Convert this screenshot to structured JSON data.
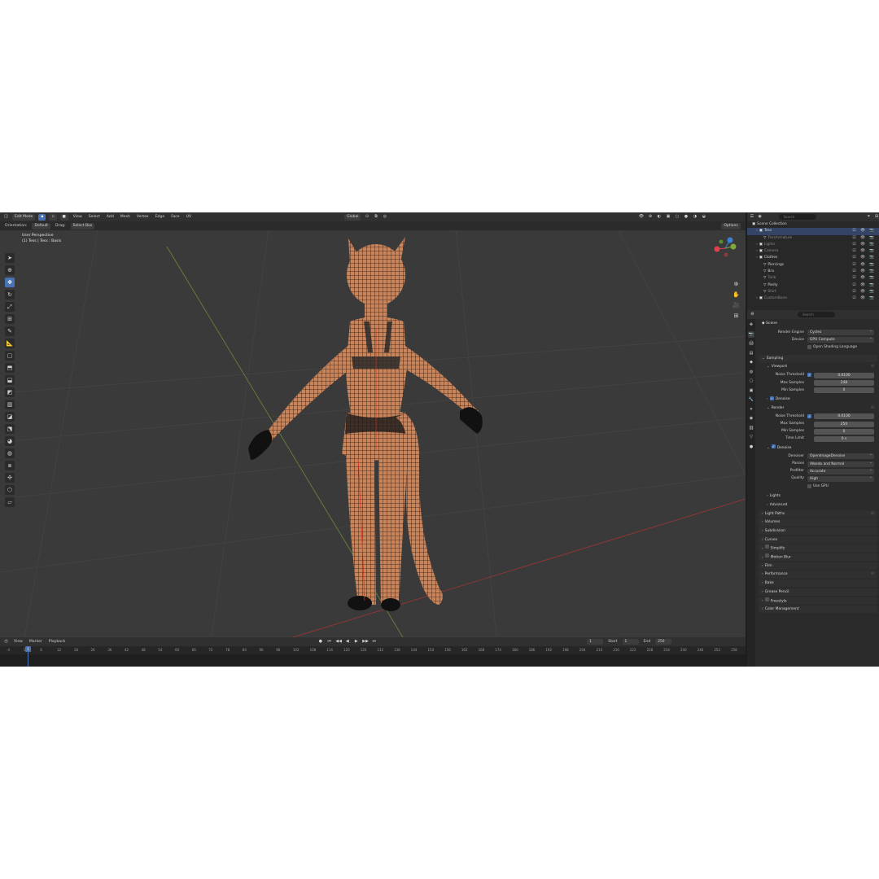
{
  "header": {
    "mode": "Edit Mode",
    "menus": [
      "View",
      "Select",
      "Add",
      "Mesh",
      "Vertex",
      "Edge",
      "Face",
      "UV"
    ],
    "transform_orientation": "Global",
    "options_label": "Options",
    "orientation_label": "Orientation:",
    "orientation_value": "Default",
    "drag_label": "Drag:",
    "drag_value": "Select Box"
  },
  "viewport": {
    "view_name": "User Perspective",
    "object_info": "(1) Tess | Tess : Basis",
    "gizmo_labels": [
      "X",
      "Y",
      "Z"
    ]
  },
  "timeline": {
    "menus": [
      "View",
      "Marker",
      "Playback"
    ],
    "current_frame": "1",
    "start_label": "Start",
    "start": "1",
    "end_label": "End",
    "end": "250",
    "ruler": [
      "-4",
      "1",
      "6",
      "12",
      "18",
      "26",
      "36",
      "42",
      "48",
      "54",
      "60",
      "66",
      "72",
      "78",
      "84",
      "90",
      "96",
      "102",
      "108",
      "114",
      "120",
      "126",
      "132",
      "138",
      "144",
      "150",
      "156",
      "162",
      "168",
      "174",
      "180",
      "186",
      "192",
      "198",
      "204",
      "210",
      "216",
      "222",
      "228",
      "234",
      "240",
      "246",
      "252",
      "258"
    ]
  },
  "outliner": {
    "search_placeholder": "Search",
    "rows": [
      {
        "label": "Scene Collection",
        "indent": 0,
        "dim": false
      },
      {
        "label": "Tess",
        "indent": 1,
        "dim": false
      },
      {
        "label": "TessArmature",
        "indent": 2,
        "dim": true
      },
      {
        "label": "Lights",
        "indent": 1,
        "dim": true
      },
      {
        "label": "Camera",
        "indent": 1,
        "dim": true
      },
      {
        "label": "Clothes",
        "indent": 1,
        "dim": false
      },
      {
        "label": "Piercings",
        "indent": 2,
        "dim": false
      },
      {
        "label": "Bra",
        "indent": 2,
        "dim": false
      },
      {
        "label": "Tank",
        "indent": 2,
        "dim": true
      },
      {
        "label": "Panty",
        "indent": 2,
        "dim": false
      },
      {
        "label": "Shirt",
        "indent": 2,
        "dim": true
      },
      {
        "label": "CustomBone",
        "indent": 1,
        "dim": true
      }
    ]
  },
  "properties": {
    "search_placeholder": "Search",
    "scene": "Scene",
    "render_engine_label": "Render Engine",
    "render_engine": "Cycles",
    "device_label": "Device",
    "device": "GPU Compute",
    "osl_label": "Open Shading Language",
    "sampling": "Sampling",
    "viewport": "Viewport",
    "noise_threshold_label": "Noise Threshold",
    "vp_noise_threshold": "0.0100",
    "max_samples_label": "Max Samples",
    "vp_max_samples": "248",
    "min_samples_label": "Min Samples",
    "vp_min_samples": "0",
    "denoise": "Denoise",
    "render": "Render",
    "r_noise_threshold": "0.0100",
    "r_max_samples": "250",
    "r_min_samples": "0",
    "time_limit_label": "Time Limit",
    "time_limit": "0 s",
    "denoiser_label": "Denoiser",
    "denoiser": "OpenImageDenoise",
    "passes_label": "Passes",
    "passes": "Albedo and Normal",
    "prefilter_label": "Prefilter",
    "prefilter": "Accurate",
    "quality_label": "Quality",
    "quality": "High",
    "use_gpu": "Use GPU",
    "lights": "Lights",
    "advanced": "Advanced",
    "light_paths": "Light Paths",
    "volumes": "Volumes",
    "subdivision": "Subdivision",
    "curves": "Curves",
    "simplify": "Simplify",
    "motion_blur": "Motion Blur",
    "film": "Film",
    "performance": "Performance",
    "bake": "Bake",
    "grease_pencil": "Grease Pencil",
    "freestyle": "Freestyle",
    "color_management": "Color Management"
  },
  "colors": {
    "accent": "#4772b3",
    "skin": "#c8845a",
    "x_axis": "#e0404e",
    "y_axis": "#7fa83a",
    "z_axis": "#3c7fd6"
  }
}
